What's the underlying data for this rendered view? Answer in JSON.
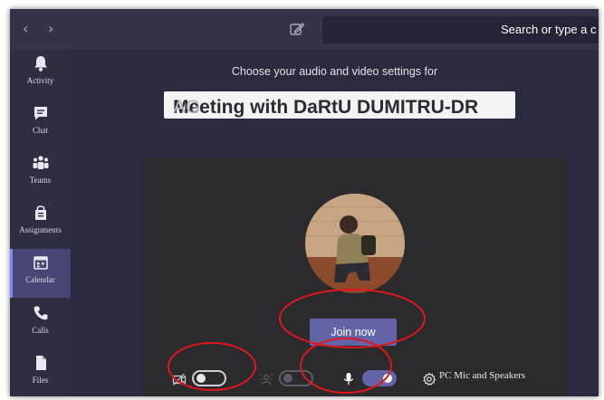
{
  "nav": {
    "back_icon": "chevron-left-icon",
    "forward_icon": "chevron-right-icon",
    "compose_icon": "compose-icon"
  },
  "search": {
    "placeholder": "Search or type a c"
  },
  "sidebar": {
    "items": [
      {
        "label": "Activity",
        "icon": "bell-icon"
      },
      {
        "label": "Chat",
        "icon": "chat-icon"
      },
      {
        "label": "Teams",
        "icon": "teams-icon"
      },
      {
        "label": "Assignments",
        "icon": "assignments-icon"
      },
      {
        "label": "Calendar",
        "icon": "calendar-icon",
        "active": true
      },
      {
        "label": "Calls",
        "icon": "phone-icon"
      },
      {
        "label": "Files",
        "icon": "file-icon"
      }
    ]
  },
  "prejoin": {
    "subtitle": "Choose your audio and video settings for",
    "meeting_title": "Meeting with DaRtU DUMITRU-DR",
    "meeting_title_fade": "AG",
    "join_label": "Join now",
    "camera_toggle": "off",
    "background_blur_toggle": "off",
    "mic_toggle": "on",
    "device_label": "PC Mic and Speakers"
  },
  "colors": {
    "accent": "#6264a7",
    "annotation": "#e0161b",
    "rail": "#2d2e40",
    "panel": "#2b2b2e"
  }
}
